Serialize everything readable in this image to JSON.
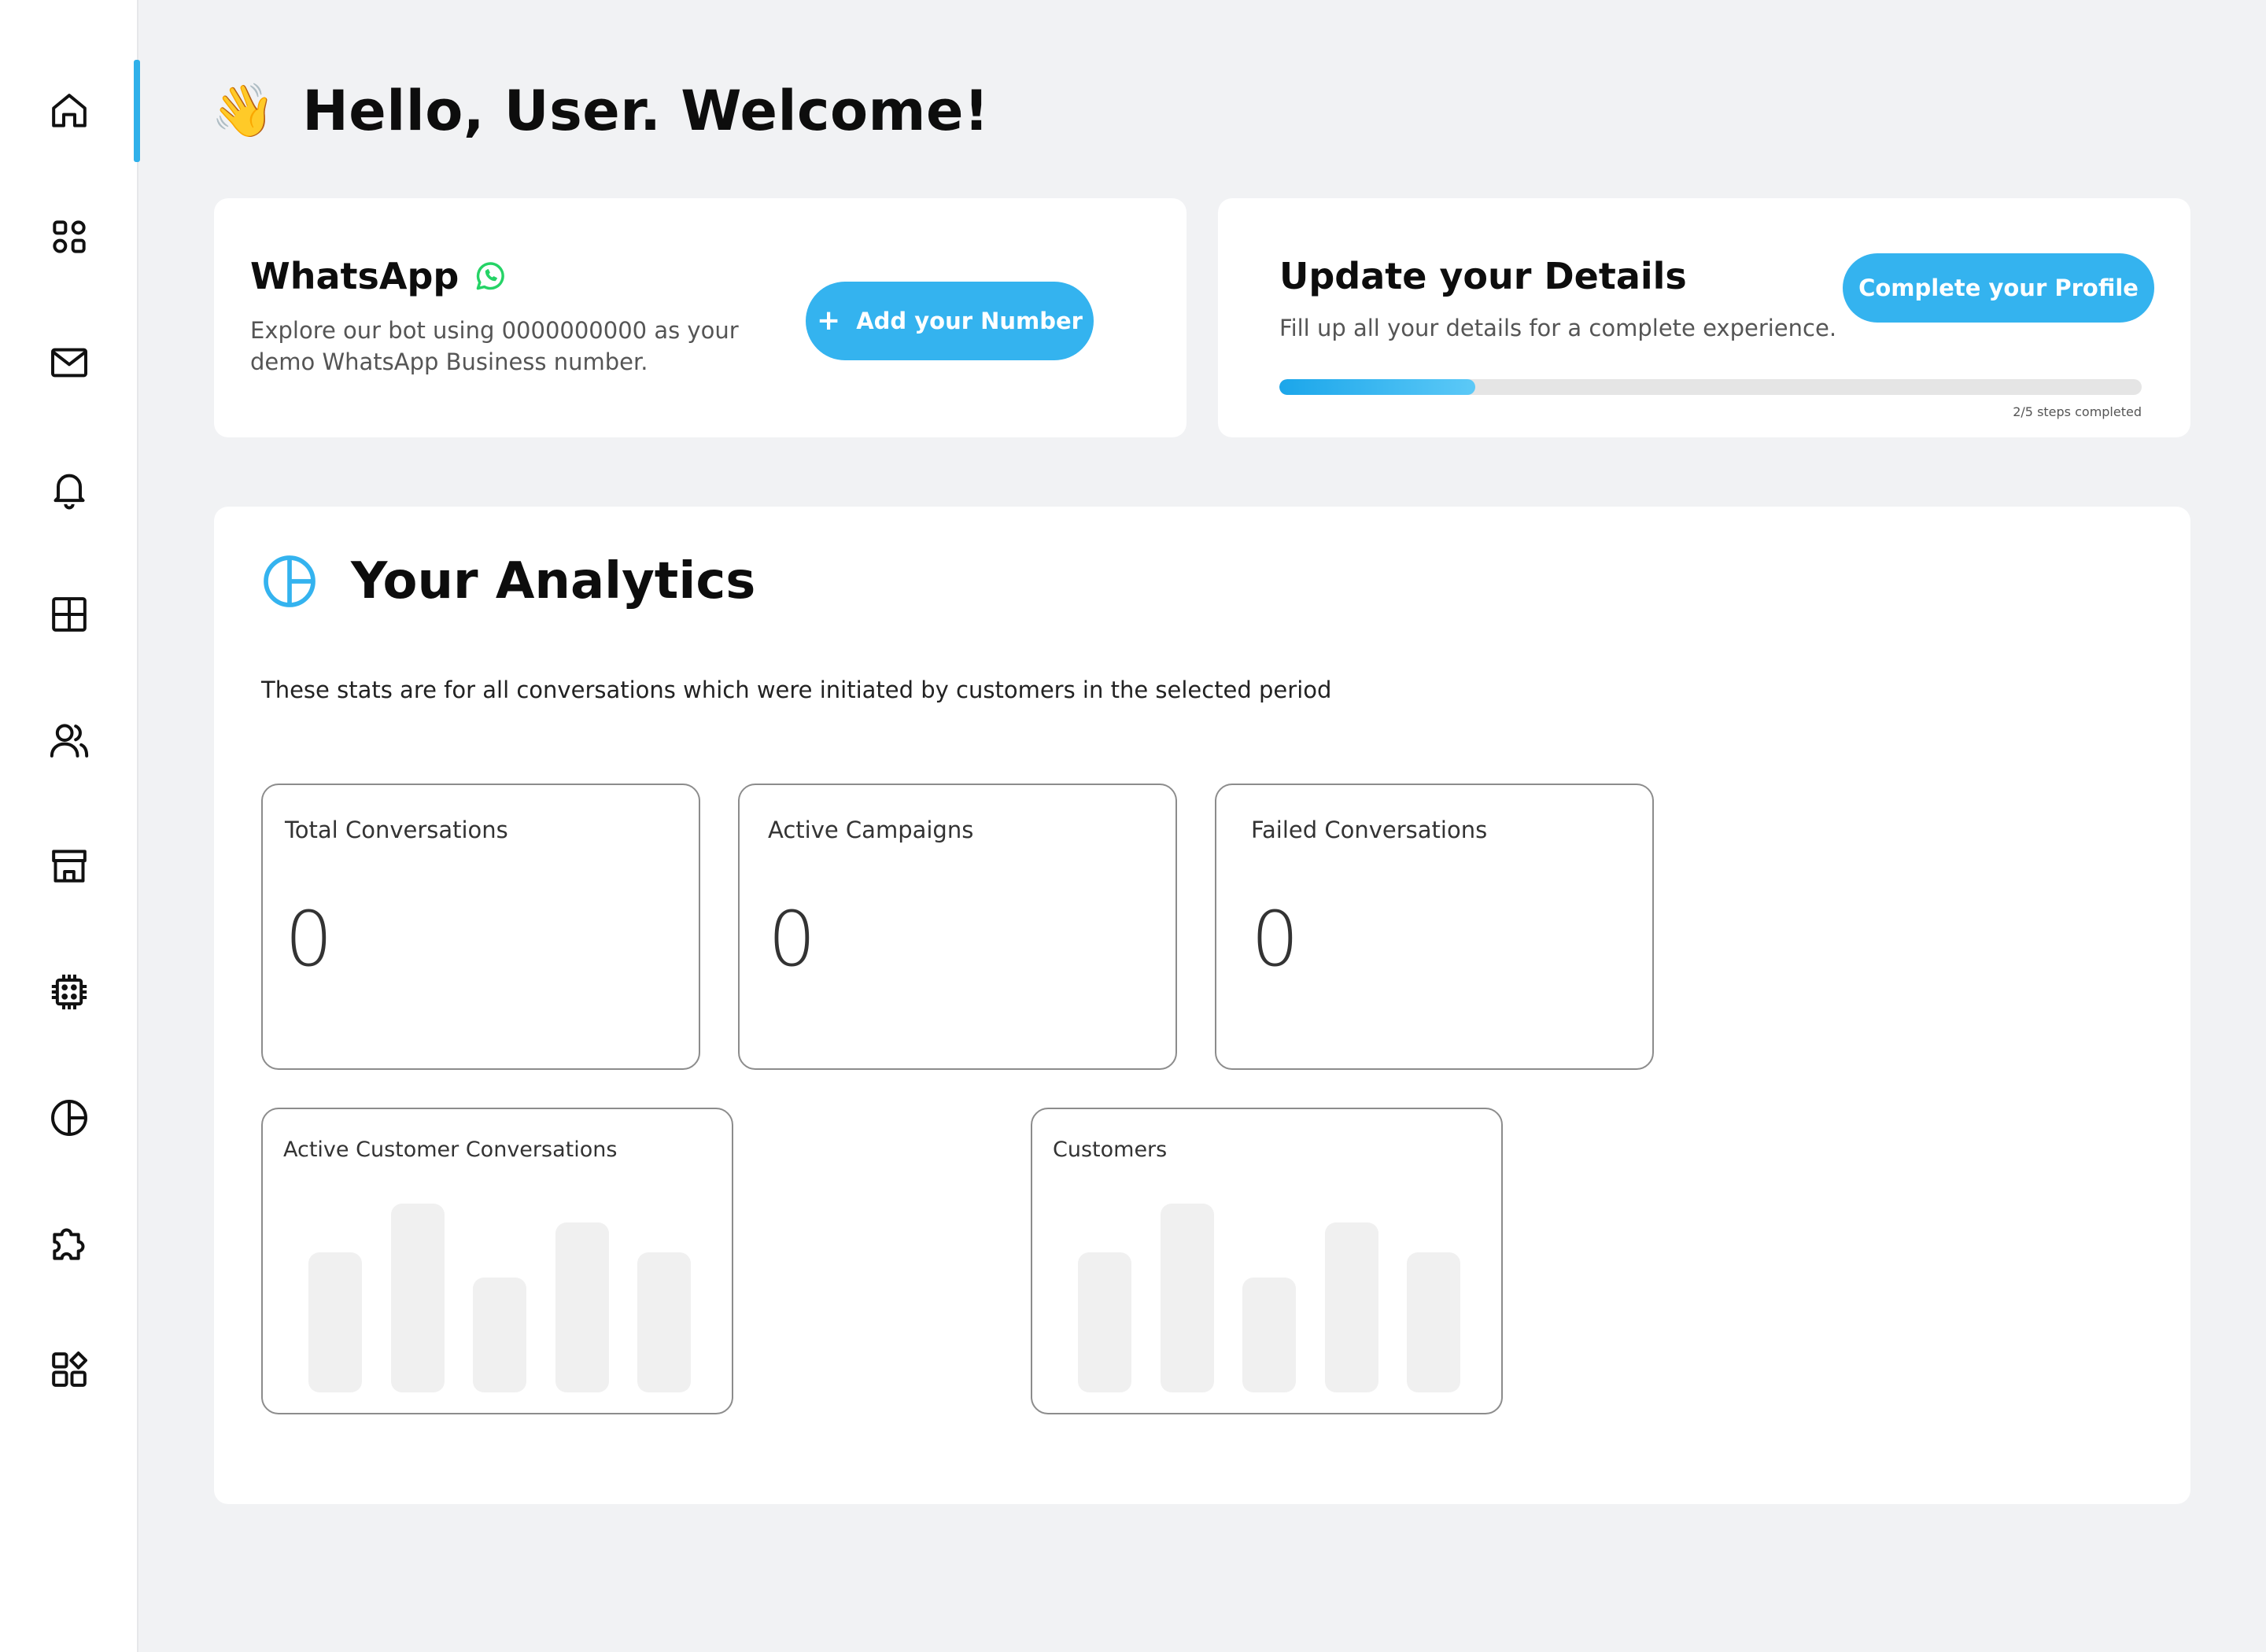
{
  "colors": {
    "accent": "#34b3ef",
    "whatsapp_green": "#25d366",
    "background": "#f1f2f4",
    "card": "#ffffff"
  },
  "sidebar": {
    "items": [
      {
        "icon": "home-icon",
        "active": true
      },
      {
        "icon": "grid-icon",
        "active": false
      },
      {
        "icon": "mail-icon",
        "active": false
      },
      {
        "icon": "bell-icon",
        "active": false
      },
      {
        "icon": "table-icon",
        "active": false
      },
      {
        "icon": "users-icon",
        "active": false
      },
      {
        "icon": "store-icon",
        "active": false
      },
      {
        "icon": "chip-icon",
        "active": false
      },
      {
        "icon": "pie-chart-icon",
        "active": false
      },
      {
        "icon": "puzzle-icon",
        "active": false
      },
      {
        "icon": "apps-icon",
        "active": false
      }
    ]
  },
  "greeting": {
    "emoji": "👋",
    "text": "Hello, User. Welcome!"
  },
  "whatsapp_card": {
    "title": "WhatsApp",
    "description": "Explore our bot using 0000000000 as your demo WhatsApp Business number.",
    "button_icon": "+",
    "button_label": "Add your Number"
  },
  "details_card": {
    "title": "Update your Details",
    "description": "Fill up all your details for a complete experience.",
    "button_label": "Complete your Profile",
    "progress_fraction": 0.227,
    "progress_label": "2/5 steps completed"
  },
  "analytics": {
    "title": "Your Analytics",
    "description": "These stats are for all conversations which were initiated by customers in the selected period",
    "stats": [
      {
        "label": "Total Conversations",
        "value": "0"
      },
      {
        "label": "Active Campaigns",
        "value": "0"
      },
      {
        "label": "Failed Conversations",
        "value": "0"
      }
    ],
    "charts": [
      {
        "label": "Active Customer Conversations",
        "bars": [
          0.74,
          1.0,
          0.61,
          0.9,
          0.74
        ]
      },
      {
        "label": "Customers",
        "bars": [
          0.74,
          1.0,
          0.61,
          0.9,
          0.74
        ]
      }
    ]
  }
}
